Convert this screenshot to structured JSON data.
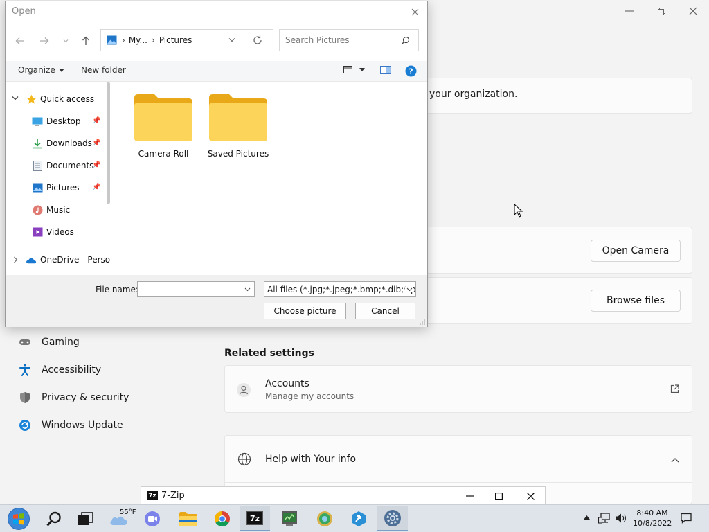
{
  "dialog": {
    "title": "Open",
    "breadcrumb": [
      "My...",
      "Pictures"
    ],
    "search_placeholder": "Search Pictures",
    "toolbar": {
      "organize": "Organize",
      "new_folder": "New folder"
    },
    "tree": [
      {
        "label": "Quick access",
        "icon": "star-icon"
      },
      {
        "label": "Desktop",
        "icon": "desktop-icon",
        "pinned": true
      },
      {
        "label": "Downloads",
        "icon": "download-icon",
        "pinned": true
      },
      {
        "label": "Documents",
        "icon": "document-icon",
        "pinned": true
      },
      {
        "label": "Pictures",
        "icon": "pictures-icon",
        "pinned": true
      },
      {
        "label": "Music",
        "icon": "music-icon"
      },
      {
        "label": "Videos",
        "icon": "video-icon"
      },
      {
        "label": "OneDrive - Perso",
        "icon": "cloud-icon"
      }
    ],
    "folders": [
      "Camera Roll",
      "Saved Pictures"
    ],
    "file_name_label": "File name:",
    "file_name_value": "",
    "file_type": "All files (*.jpg;*.jpeg;*.bmp;*.dib;*.png",
    "choose_button": "Choose picture",
    "cancel_button": "Cancel"
  },
  "settings": {
    "org_text": "your organization.",
    "open_camera": "Open Camera",
    "browse_files": "Browse files",
    "nav": [
      "Gaming",
      "Accessibility",
      "Privacy & security",
      "Windows Update"
    ],
    "related_settings": "Related settings",
    "accounts": {
      "title": "Accounts",
      "subtitle": "Manage my accounts"
    },
    "help": "Help with Your info"
  },
  "zip_window": {
    "title": "7-Zip",
    "icon_text": "7z"
  },
  "taskbar": {
    "weather": "55°F",
    "time": "8:40 AM",
    "date": "10/8/2022"
  },
  "colors": {
    "folder": "#f7c843",
    "accent": "#0067c0"
  }
}
